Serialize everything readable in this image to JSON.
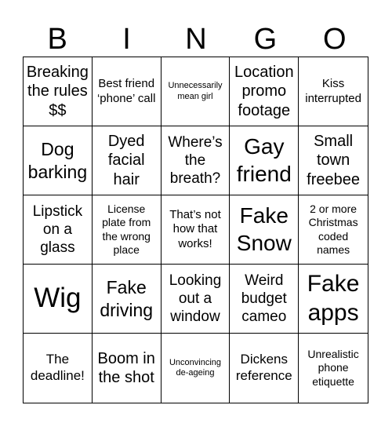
{
  "header": [
    "B",
    "I",
    "N",
    "G",
    "O"
  ],
  "cells": [
    "Breaking the rules $$",
    "Best friend ‘phone’ call",
    "Unnecessarily mean girl",
    "Location promo footage",
    "Kiss interrupted",
    "Dog barking",
    "Dyed facial hair",
    "Where’s the breath?",
    "Gay friend",
    "Small town freebee",
    "Lipstick on a glass",
    "License plate from the wrong place",
    "That’s not how that works!",
    "Fake Snow",
    "2 or more Christmas coded names",
    "Wig",
    "Fake driving",
    "Looking out a window",
    "Weird budget cameo",
    "Fake apps",
    "The deadline!",
    "Boom in the shot",
    "Unconvincing de-ageing",
    "Dickens reference",
    "Unrealistic phone etiquette"
  ]
}
